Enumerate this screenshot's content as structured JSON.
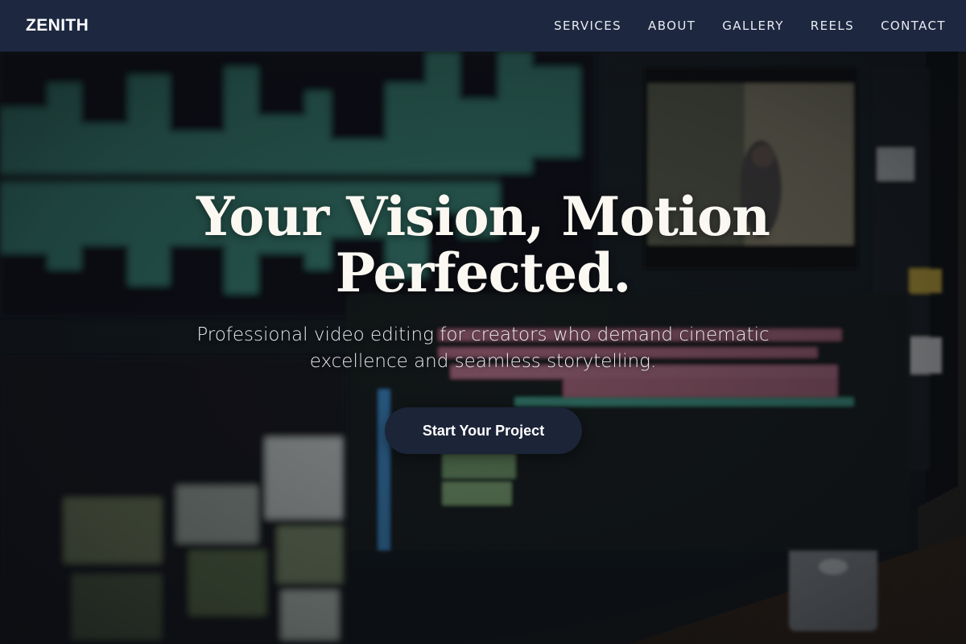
{
  "brand": {
    "name": "ZENITH"
  },
  "nav": {
    "links": [
      "SERVICES",
      "ABOUT",
      "GALLERY",
      "REELS",
      "CONTACT"
    ]
  },
  "hero": {
    "title_line1": "Your Vision, Motion",
    "title_line2": "Perfected.",
    "subtitle_line1": "Professional video editing for creators who demand cinematic",
    "subtitle_line2": "excellence and seamless storytelling.",
    "cta_label": "Start Your Project",
    "background_image": "video-editing-workstation"
  },
  "colors": {
    "nav_bg": "#1d2840",
    "cta_bg": "#1c2438",
    "title_text": "#fbf8f2",
    "waveform_accent": "#3f9a86",
    "timeline_pink": "#a8657a"
  }
}
